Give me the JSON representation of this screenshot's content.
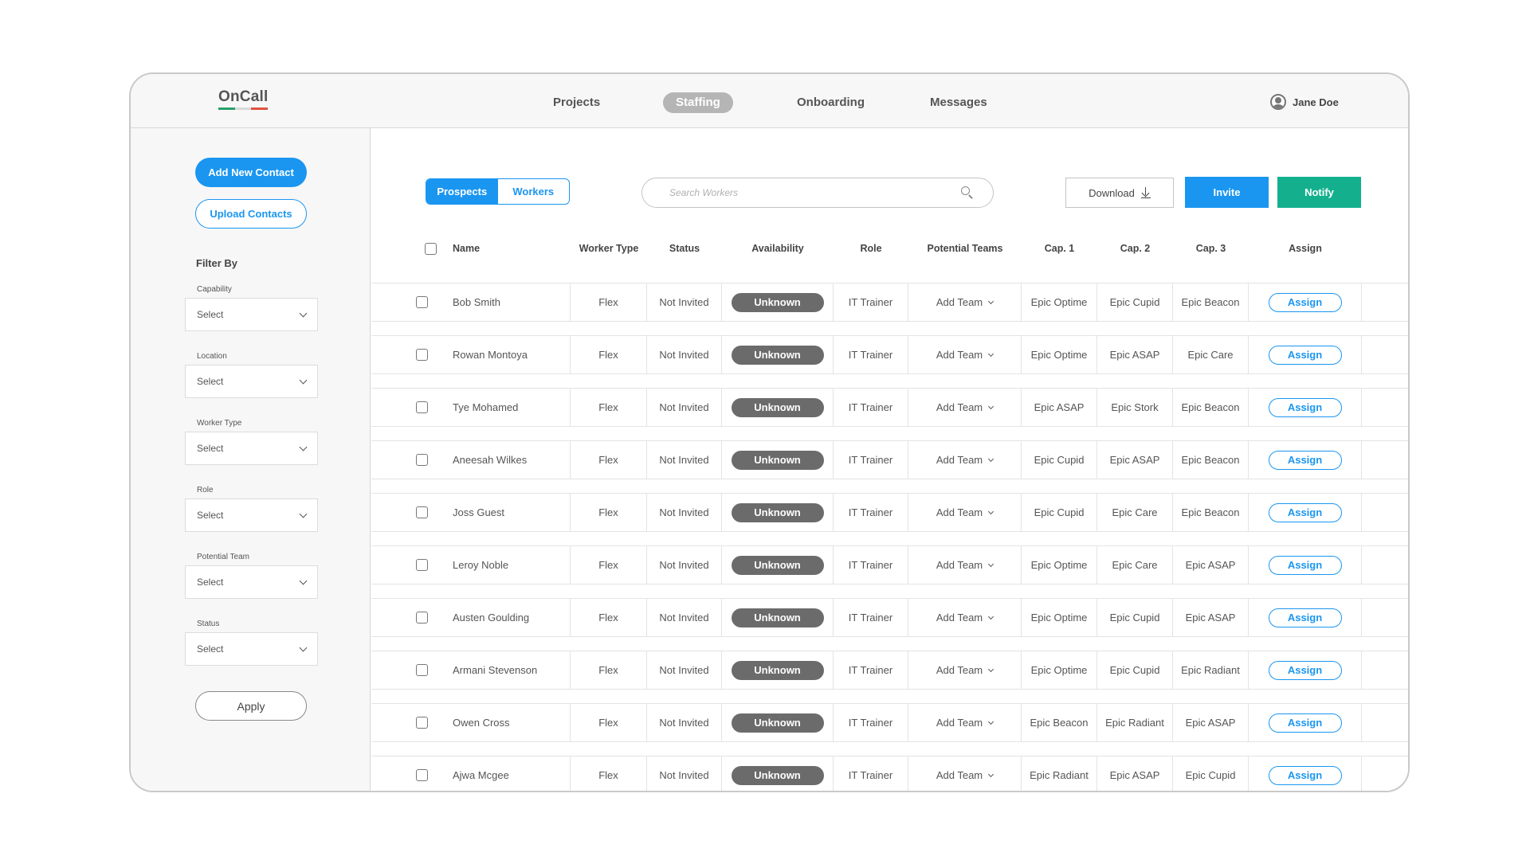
{
  "app": {
    "logo": "OnCall",
    "logo_colors": [
      "#2aa06a",
      "#d9d9d9",
      "#e0533d"
    ]
  },
  "nav": {
    "items": [
      {
        "label": "Projects",
        "active": false
      },
      {
        "label": "Staffing",
        "active": true
      },
      {
        "label": "Onboarding",
        "active": false
      },
      {
        "label": "Messages",
        "active": false
      }
    ],
    "user_name": "Jane Doe"
  },
  "sidebar": {
    "add_contact_label": "Add New Contact",
    "upload_contacts_label": "Upload Contacts",
    "filter_title": "Filter By",
    "filters": [
      {
        "label": "Capability",
        "value": "Select"
      },
      {
        "label": "Location",
        "value": "Select"
      },
      {
        "label": "Worker Type",
        "value": "Select"
      },
      {
        "label": "Role",
        "value": "Select"
      },
      {
        "label": "Potential Team",
        "value": "Select"
      },
      {
        "label": "Status",
        "value": "Select"
      }
    ],
    "apply_label": "Apply"
  },
  "toolbar": {
    "tabs": [
      {
        "label": "Prospects",
        "active": true
      },
      {
        "label": "Workers",
        "active": false
      }
    ],
    "search_placeholder": "Search Workers",
    "download_label": "Download",
    "invite_label": "Invite",
    "notify_label": "Notify",
    "accent_color": "#1a96f0",
    "notify_color": "#14b08e"
  },
  "table": {
    "headers": {
      "name": "Name",
      "worker_type": "Worker Type",
      "status": "Status",
      "availability": "Availability",
      "role": "Role",
      "potential_teams": "Potential Teams",
      "cap1": "Cap. 1",
      "cap2": "Cap. 2",
      "cap3": "Cap. 3",
      "assign": "Assign"
    },
    "rows": [
      {
        "name": "Bob Smith",
        "worker_type": "Flex",
        "status": "Not Invited",
        "availability": "Unknown",
        "role": "IT Trainer",
        "team": "Add Team",
        "cap1": "Epic Optime",
        "cap2": "Epic Cupid",
        "cap3": "Epic Beacon",
        "assign": "Assign"
      },
      {
        "name": "Rowan Montoya",
        "worker_type": "Flex",
        "status": "Not Invited",
        "availability": "Unknown",
        "role": "IT Trainer",
        "team": "Add Team",
        "cap1": "Epic Optime",
        "cap2": "Epic ASAP",
        "cap3": "Epic Care",
        "assign": "Assign"
      },
      {
        "name": "Tye Mohamed",
        "worker_type": "Flex",
        "status": "Not Invited",
        "availability": "Unknown",
        "role": "IT Trainer",
        "team": "Add Team",
        "cap1": "Epic ASAP",
        "cap2": "Epic Stork",
        "cap3": "Epic Beacon",
        "assign": "Assign"
      },
      {
        "name": "Aneesah Wilkes",
        "worker_type": "Flex",
        "status": "Not Invited",
        "availability": "Unknown",
        "role": "IT Trainer",
        "team": "Add Team",
        "cap1": "Epic Cupid",
        "cap2": "Epic ASAP",
        "cap3": "Epic Beacon",
        "assign": "Assign"
      },
      {
        "name": "Joss Guest",
        "worker_type": "Flex",
        "status": "Not Invited",
        "availability": "Unknown",
        "role": "IT Trainer",
        "team": "Add Team",
        "cap1": "Epic Cupid",
        "cap2": "Epic Care",
        "cap3": "Epic Beacon",
        "assign": "Assign"
      },
      {
        "name": "Leroy Noble",
        "worker_type": "Flex",
        "status": "Not Invited",
        "availability": "Unknown",
        "role": "IT Trainer",
        "team": "Add Team",
        "cap1": "Epic Optime",
        "cap2": "Epic Care",
        "cap3": "Epic ASAP",
        "assign": "Assign"
      },
      {
        "name": "Austen Goulding",
        "worker_type": "Flex",
        "status": "Not Invited",
        "availability": "Unknown",
        "role": "IT Trainer",
        "team": "Add Team",
        "cap1": "Epic Optime",
        "cap2": "Epic Cupid",
        "cap3": "Epic ASAP",
        "assign": "Assign"
      },
      {
        "name": "Armani Stevenson",
        "worker_type": "Flex",
        "status": "Not Invited",
        "availability": "Unknown",
        "role": "IT Trainer",
        "team": "Add Team",
        "cap1": "Epic Optime",
        "cap2": "Epic Cupid",
        "cap3": "Epic Radiant",
        "assign": "Assign"
      },
      {
        "name": "Owen Cross",
        "worker_type": "Flex",
        "status": "Not Invited",
        "availability": "Unknown",
        "role": "IT Trainer",
        "team": "Add Team",
        "cap1": "Epic Beacon",
        "cap2": "Epic Radiant",
        "cap3": "Epic ASAP",
        "assign": "Assign"
      },
      {
        "name": "Ajwa Mcgee",
        "worker_type": "Flex",
        "status": "Not Invited",
        "availability": "Unknown",
        "role": "IT Trainer",
        "team": "Add Team",
        "cap1": "Epic Radiant",
        "cap2": "Epic ASAP",
        "cap3": "Epic Cupid",
        "assign": "Assign"
      }
    ]
  }
}
